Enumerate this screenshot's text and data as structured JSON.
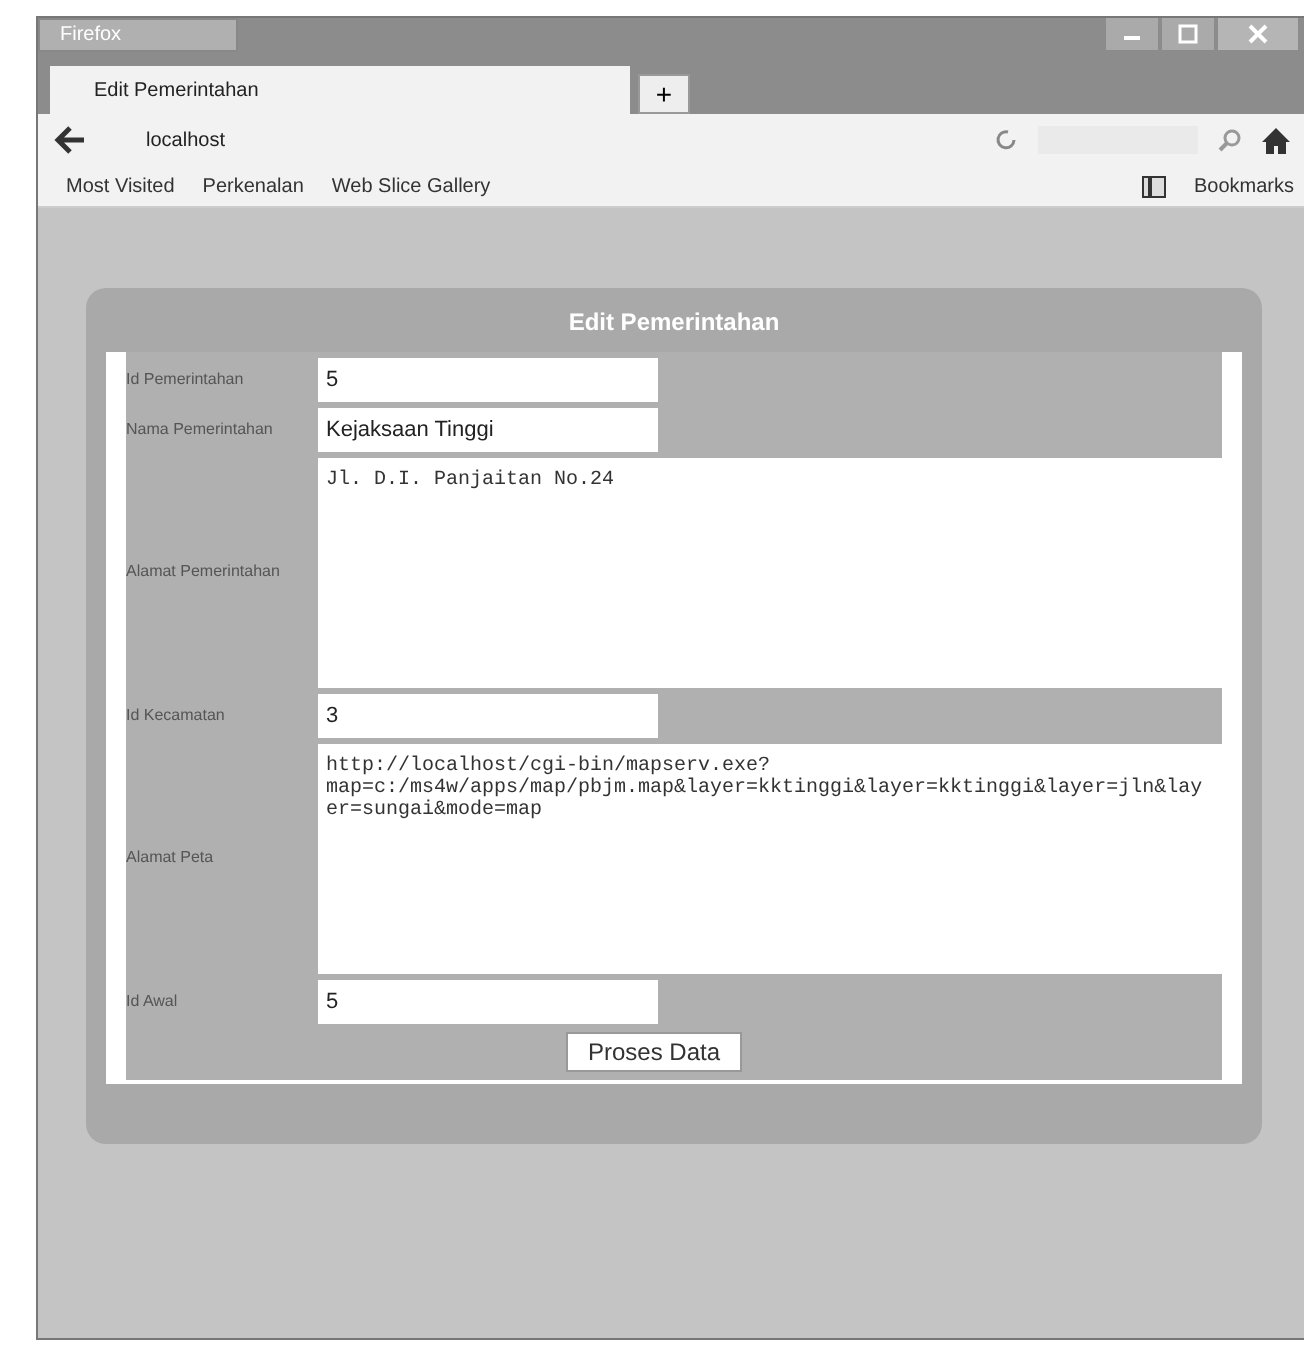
{
  "window": {
    "app_menu": "Firefox"
  },
  "tabs": [
    {
      "label": "Edit Pemerintahan",
      "selected": true
    }
  ],
  "new_tab": "+",
  "address_bar": {
    "value": "localhost"
  },
  "bookmarks": [
    "Most Visited",
    "Perkenalan",
    "Web Slice Gallery"
  ],
  "bookmarks_menu": "Bookmarks",
  "form": {
    "title": "Edit Pemerintahan",
    "fields": [
      {
        "label": "Id Pemerintahan",
        "kind": "text",
        "value": "5"
      },
      {
        "label": "Nama Pemerintahan",
        "kind": "text",
        "value": "Kejaksaan Tinggi"
      },
      {
        "label": "Alamat Pemerintahan",
        "kind": "textarea",
        "value": "Jl. D.I. Panjaitan No.24"
      },
      {
        "label": "Id Kecamatan",
        "kind": "text",
        "value": "3"
      },
      {
        "label": "Alamat Peta",
        "kind": "textarea",
        "value": "http://localhost/cgi-bin/mapserv.exe?map=c:/ms4w/apps/map/pbjm.map&layer=kktinggi&layer=kktinggi&layer=jln&layer=sungai&mode=map"
      },
      {
        "label": "Id Awal",
        "kind": "text",
        "value": "5"
      }
    ],
    "submit": "Proses Data"
  }
}
